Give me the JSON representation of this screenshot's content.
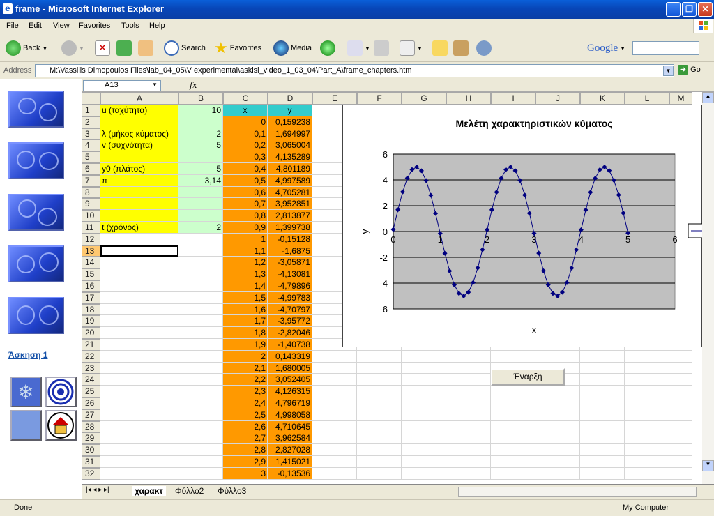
{
  "window": {
    "title": "frame - Microsoft Internet Explorer",
    "icon": "ie-icon"
  },
  "menu": [
    "File",
    "Edit",
    "View",
    "Favorites",
    "Tools",
    "Help"
  ],
  "toolbar": {
    "back": "Back",
    "search": "Search",
    "favorites": "Favorites",
    "media": "Media",
    "google": "Google"
  },
  "address": {
    "label": "Address",
    "url": "M:\\Vassilis Dimopoulos Files\\lab_04_05\\V experimental\\askisi_video_1_03_04\\Part_A\\frame_chapters.htm",
    "go": "Go"
  },
  "left": {
    "link": "Άσκηση 1"
  },
  "excel": {
    "namebox": "A13",
    "fx": "fx",
    "columns": [
      "A",
      "B",
      "C",
      "D",
      "E",
      "F",
      "G",
      "H",
      "I",
      "J",
      "K",
      "L",
      "M"
    ],
    "rows": [
      "1",
      "2",
      "3",
      "4",
      "5",
      "6",
      "7",
      "8",
      "9",
      "10",
      "11",
      "12",
      "13",
      "14",
      "15",
      "16",
      "17",
      "18",
      "19",
      "20",
      "21",
      "22",
      "23",
      "24",
      "25",
      "26",
      "27",
      "28",
      "29",
      "30",
      "31",
      "32"
    ],
    "params": [
      {
        "label": "u (ταχύτητα)",
        "value": "10"
      },
      {
        "label": "",
        "value": ""
      },
      {
        "label": "λ (μήκος κύματος)",
        "value": "2"
      },
      {
        "label": "v (συχνότητα)",
        "value": "5"
      },
      {
        "label": "",
        "value": ""
      },
      {
        "label": "y0 (πλάτος)",
        "value": "5"
      },
      {
        "label": "π",
        "value": "3,14"
      },
      {
        "label": "",
        "value": ""
      },
      {
        "label": "",
        "value": ""
      },
      {
        "label": "",
        "value": ""
      },
      {
        "label": "t (χρόνος)",
        "value": "2"
      }
    ],
    "x_header": "x",
    "y_header": "y",
    "x_values": [
      "0",
      "0,1",
      "0,2",
      "0,3",
      "0,4",
      "0,5",
      "0,6",
      "0,7",
      "0,8",
      "0,9",
      "1",
      "1,1",
      "1,2",
      "1,3",
      "1,4",
      "1,5",
      "1,6",
      "1,7",
      "1,8",
      "1,9",
      "2",
      "2,1",
      "2,2",
      "2,3",
      "2,4",
      "2,5",
      "2,6",
      "2,7",
      "2,8",
      "2,9",
      "3"
    ],
    "y_values": [
      "0,159238",
      "1,694997",
      "3,065004",
      "4,135289",
      "4,801189",
      "4,997589",
      "4,705281",
      "3,952851",
      "2,813877",
      "1,399738",
      "-0,15128",
      "-1,6875",
      "-3,05871",
      "-4,13081",
      "-4,79896",
      "-4,99783",
      "-4,70797",
      "-3,95772",
      "-2,82046",
      "-1,40738",
      "0,143319",
      "1,680005",
      "3,052405",
      "4,126315",
      "4,796719",
      "4,998058",
      "4,710645",
      "3,962584",
      "2,827028",
      "1,415021",
      "-0,13536"
    ],
    "sheets": [
      "χαρακτ",
      "Φύλλο2",
      "Φύλλο3"
    ],
    "start_button": "Έναρξη"
  },
  "chart_data": {
    "type": "line",
    "title": "Μελέτη χαρακτηριστικών κύματος",
    "xlabel": "x",
    "ylabel": "y",
    "xlim": [
      0,
      6
    ],
    "ylim": [
      -6,
      6
    ],
    "xticks": [
      "0",
      "1",
      "2",
      "3",
      "4",
      "5",
      "6"
    ],
    "yticks": [
      "6",
      "4",
      "2",
      "0",
      "-2",
      "-4",
      "-6"
    ],
    "plot_bg": "#c0c0c0",
    "line_color": "#000080",
    "x": [
      0,
      0.1,
      0.2,
      0.3,
      0.4,
      0.5,
      0.6,
      0.7,
      0.8,
      0.9,
      1,
      1.1,
      1.2,
      1.3,
      1.4,
      1.5,
      1.6,
      1.7,
      1.8,
      1.9,
      2,
      2.1,
      2.2,
      2.3,
      2.4,
      2.5,
      2.6,
      2.7,
      2.8,
      2.9,
      3,
      3.1,
      3.2,
      3.3,
      3.4,
      3.5,
      3.6,
      3.7,
      3.8,
      3.9,
      4,
      4.1,
      4.2,
      4.3,
      4.4,
      4.5,
      4.6,
      4.7,
      4.8,
      4.9,
      5
    ],
    "y": [
      0.16,
      1.69,
      3.07,
      4.14,
      4.8,
      5.0,
      4.71,
      3.95,
      2.81,
      1.4,
      -0.15,
      -1.69,
      -3.06,
      -4.13,
      -4.8,
      -5.0,
      -4.71,
      -3.96,
      -2.82,
      -1.41,
      0.14,
      1.68,
      3.05,
      4.13,
      4.8,
      5.0,
      4.71,
      3.96,
      2.83,
      1.42,
      -0.14,
      -1.68,
      -3.05,
      -4.13,
      -4.8,
      -5.0,
      -4.71,
      -3.96,
      -2.83,
      -1.42,
      0.13,
      1.67,
      3.04,
      4.12,
      4.79,
      5.0,
      4.72,
      3.97,
      2.84,
      1.43,
      -0.12
    ]
  },
  "status": {
    "left": "Done",
    "right": "My Computer"
  }
}
